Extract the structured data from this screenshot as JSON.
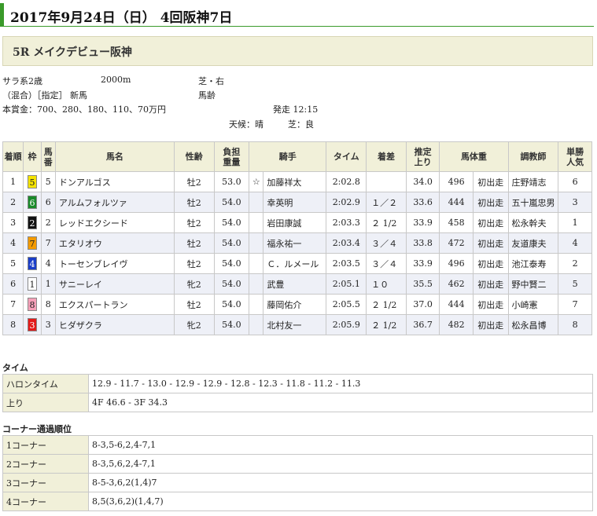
{
  "header": {
    "date_title": "2017年9月24日（日） 4回阪神7日"
  },
  "race": {
    "name": "5R メイクデビュー阪神",
    "class": "サラ系2歳",
    "distance": "2000m",
    "surface": "芝・右",
    "conditions": "（混合）［指定］ 新馬",
    "weight_rule": "馬齢",
    "prize": "本賞金：700、280、180、110、70万円",
    "start_time": "発走 12:15",
    "weather": "天候：晴",
    "going": "芝：良"
  },
  "results": {
    "headers": {
      "pos": "着順",
      "waku": "枠",
      "num": "馬番",
      "horse": "馬名",
      "sexage": "性齢",
      "weight": "負担重量",
      "jockey": "騎手",
      "time": "タイム",
      "margin": "着差",
      "last3f": "推定上り",
      "body": "馬体重",
      "trainer": "調教師",
      "pop": "単勝人気"
    },
    "rows": [
      {
        "pos": "1",
        "waku": "5",
        "num": "5",
        "horse": "ドンアルゴス",
        "sexage": "牡2",
        "weight": "53.0",
        "mark": "☆",
        "jockey": "加藤祥太",
        "time": "2:02.8",
        "margin": "",
        "last3f": "34.0",
        "body": "496",
        "diff": "初出走",
        "trainer": "庄野靖志",
        "pop": "6",
        "waku_bg": "#f5e400",
        "waku_fg": "#222"
      },
      {
        "pos": "2",
        "waku": "6",
        "num": "6",
        "horse": "アルムフォルツァ",
        "sexage": "牡2",
        "weight": "54.0",
        "mark": "",
        "jockey": "幸英明",
        "time": "2:02.9",
        "margin": "１／２",
        "last3f": "33.6",
        "body": "444",
        "diff": "初出走",
        "trainer": "五十嵐忠男",
        "pop": "3",
        "waku_bg": "#1a8a2a",
        "waku_fg": "#fff"
      },
      {
        "pos": "3",
        "waku": "2",
        "num": "2",
        "horse": "レッドエクシード",
        "sexage": "牡2",
        "weight": "54.0",
        "mark": "",
        "jockey": "岩田康誠",
        "time": "2:03.3",
        "margin": "２ 1/2",
        "last3f": "33.9",
        "body": "458",
        "diff": "初出走",
        "trainer": "松永幹夫",
        "pop": "1",
        "waku_bg": "#111",
        "waku_fg": "#fff"
      },
      {
        "pos": "4",
        "waku": "7",
        "num": "7",
        "horse": "エタリオウ",
        "sexage": "牡2",
        "weight": "54.0",
        "mark": "",
        "jockey": "福永祐一",
        "time": "2:03.4",
        "margin": "３／４",
        "last3f": "33.8",
        "body": "472",
        "diff": "初出走",
        "trainer": "友道康夫",
        "pop": "4",
        "waku_bg": "#f39a00",
        "waku_fg": "#222"
      },
      {
        "pos": "5",
        "waku": "4",
        "num": "4",
        "horse": "トーセンブレイヴ",
        "sexage": "牡2",
        "weight": "54.0",
        "mark": "",
        "jockey": "Ｃ．ルメール",
        "time": "2:03.5",
        "margin": "３／４",
        "last3f": "33.9",
        "body": "496",
        "diff": "初出走",
        "trainer": "池江泰寿",
        "pop": "2",
        "waku_bg": "#1a3ec8",
        "waku_fg": "#fff"
      },
      {
        "pos": "6",
        "waku": "1",
        "num": "1",
        "horse": "サニーレイ",
        "sexage": "牝2",
        "weight": "54.0",
        "mark": "",
        "jockey": "武豊",
        "time": "2:05.1",
        "margin": "１０",
        "last3f": "35.5",
        "body": "462",
        "diff": "初出走",
        "trainer": "野中賢二",
        "pop": "5",
        "waku_bg": "#fff",
        "waku_fg": "#222"
      },
      {
        "pos": "7",
        "waku": "8",
        "num": "8",
        "horse": "エクスパートラン",
        "sexage": "牡2",
        "weight": "54.0",
        "mark": "",
        "jockey": "藤岡佑介",
        "time": "2:05.5",
        "margin": "２ 1/2",
        "last3f": "37.0",
        "body": "444",
        "diff": "初出走",
        "trainer": "小崎憲",
        "pop": "7",
        "waku_bg": "#f5a0b8",
        "waku_fg": "#222"
      },
      {
        "pos": "8",
        "waku": "3",
        "num": "3",
        "horse": "ヒダザクラ",
        "sexage": "牝2",
        "weight": "54.0",
        "mark": "",
        "jockey": "北村友一",
        "time": "2:05.9",
        "margin": "２ 1/2",
        "last3f": "36.7",
        "body": "482",
        "diff": "初出走",
        "trainer": "松永昌博",
        "pop": "8",
        "waku_bg": "#e31a1a",
        "waku_fg": "#fff"
      }
    ]
  },
  "times": {
    "section_title": "タイム",
    "furlong_label": "ハロンタイム",
    "furlong_value": "12.9 - 11.7 - 13.0 - 12.9 - 12.9 - 12.8 - 12.3 - 11.8 - 11.2 - 11.3",
    "agari_label": "上り",
    "agari_value": "4F 46.6 - 3F 34.3"
  },
  "corners": {
    "section_title": "コーナー通過順位",
    "items": [
      {
        "label": "1コーナー",
        "value": "8-3,5-6,2,4-7,1"
      },
      {
        "label": "2コーナー",
        "value": "8-3,5,6,2,4-7,1"
      },
      {
        "label": "3コーナー",
        "value": "8-5-3,6,2(1,4)7"
      },
      {
        "label": "4コーナー",
        "value": "8,5(3,6,2)(1,4,7)"
      }
    ]
  }
}
